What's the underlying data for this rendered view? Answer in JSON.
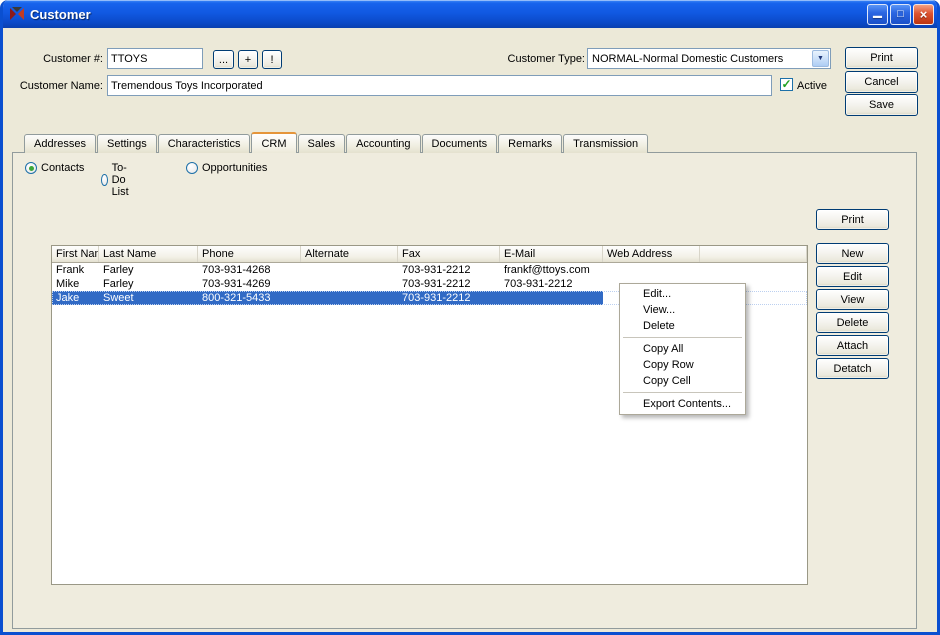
{
  "window": {
    "title": "Customer",
    "controls": {
      "minimize": "▁",
      "maximize": "□",
      "close": "×"
    }
  },
  "icons": {
    "dropdown_arrow": "▼",
    "checkbox_check": "✓"
  },
  "form": {
    "customer_number": {
      "label": "Customer #:",
      "value": "TTOYS"
    },
    "lookup_button": "...",
    "add_button": "+",
    "bang_button": "!",
    "customer_type": {
      "label": "Customer Type:",
      "value": "NORMAL-Normal Domestic Customers"
    },
    "customer_name": {
      "label": "Customer Name:",
      "value": "Tremendous Toys Incorporated"
    },
    "active_checkbox": {
      "label": "Active",
      "checked": true
    },
    "buttons": {
      "print": "Print",
      "cancel": "Cancel",
      "save": "Save"
    }
  },
  "tabs": [
    {
      "label": "Addresses"
    },
    {
      "label": "Settings"
    },
    {
      "label": "Characteristics"
    },
    {
      "label": "CRM",
      "active": true
    },
    {
      "label": "Sales"
    },
    {
      "label": "Accounting"
    },
    {
      "label": "Documents"
    },
    {
      "label": "Remarks"
    },
    {
      "label": "Transmission"
    }
  ],
  "view_options": [
    {
      "label": "Contacts",
      "selected": true
    },
    {
      "label": "To-Do List",
      "selected": false
    },
    {
      "label": "Opportunities",
      "selected": false
    }
  ],
  "contacts_panel": {
    "print_button": "Print",
    "side_buttons": [
      "New",
      "Edit",
      "View",
      "Delete",
      "Attach",
      "Detatch"
    ],
    "table": {
      "columns": [
        "First Name",
        "Last Name",
        "Phone",
        "Alternate",
        "Fax",
        "E-Mail",
        "Web Address"
      ],
      "rows": [
        [
          "Frank",
          "Farley",
          "703-931-4268",
          "",
          "703-931-2212",
          "frankf@ttoys.com",
          ""
        ],
        [
          "Mike",
          "Farley",
          "703-931-4269",
          "",
          "703-931-2212",
          "703-931-2212",
          ""
        ],
        [
          "Jake",
          "Sweet",
          "800-321-5433",
          "",
          "703-931-2212",
          "",
          ""
        ]
      ],
      "selected_row_index": 2
    }
  },
  "context_menu": {
    "groups": [
      [
        "Edit...",
        "View...",
        "Delete"
      ],
      [
        "Copy All",
        "Copy Row",
        "Copy Cell"
      ],
      [
        "Export Contents..."
      ]
    ]
  },
  "colors": {
    "selection": "#316AC5",
    "titlebar_blue": "#1159E2",
    "close_red": "#DD5330",
    "window_bg": "#ECE9D8"
  }
}
